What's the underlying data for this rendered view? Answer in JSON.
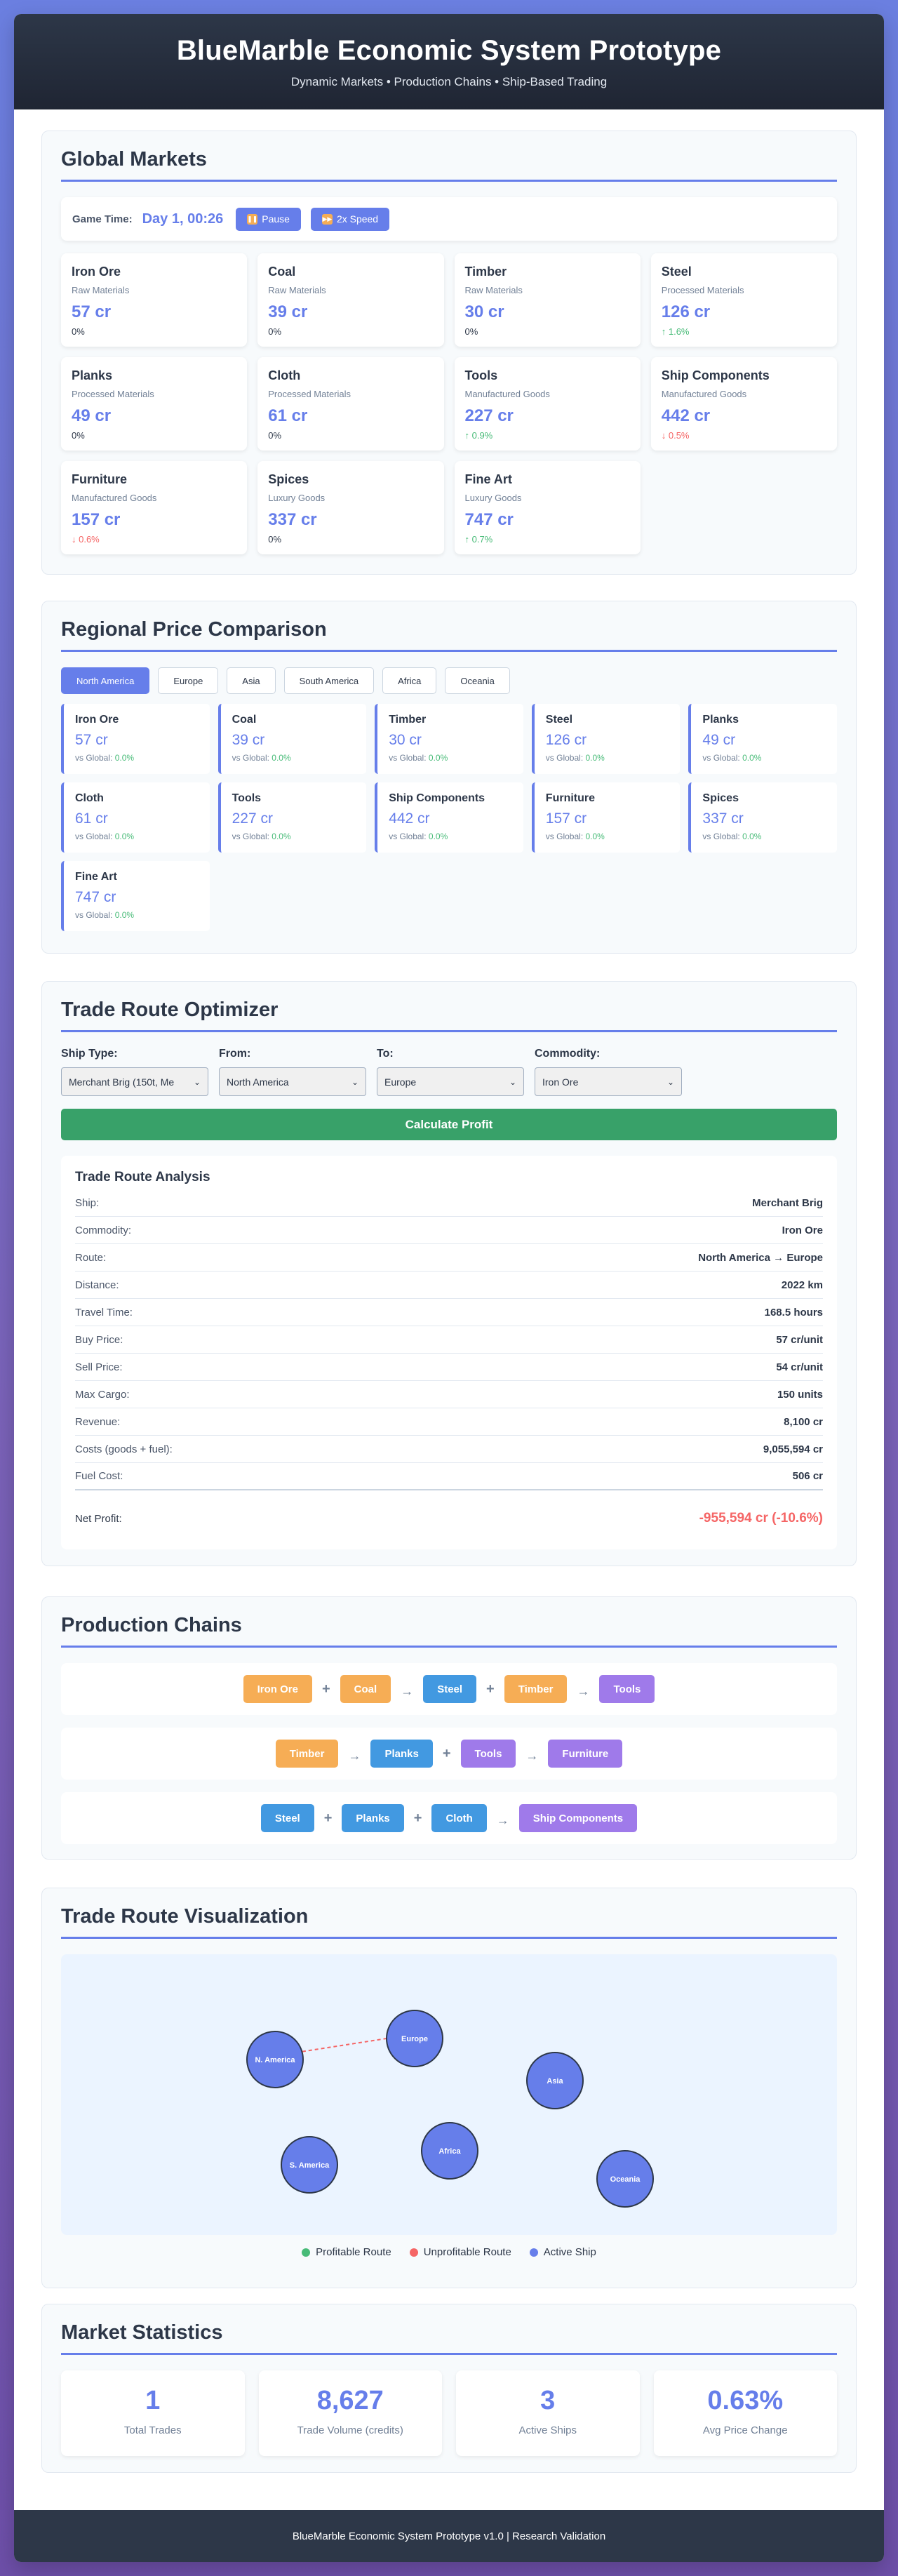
{
  "header": {
    "title": "BlueMarble Economic System Prototype",
    "subtitle": "Dynamic Markets • Production Chains • Ship-Based Trading"
  },
  "global_markets": {
    "title": "Global Markets",
    "game_time_label": "Game Time:",
    "game_time": "Day 1, 00:26",
    "pause_label": "Pause",
    "speed_label": "2x Speed",
    "items": [
      {
        "name": "Iron Ore",
        "category": "Raw Materials",
        "price": "57 cr",
        "change": "0%",
        "trend": "flat"
      },
      {
        "name": "Coal",
        "category": "Raw Materials",
        "price": "39 cr",
        "change": "0%",
        "trend": "flat"
      },
      {
        "name": "Timber",
        "category": "Raw Materials",
        "price": "30 cr",
        "change": "0%",
        "trend": "flat"
      },
      {
        "name": "Steel",
        "category": "Processed Materials",
        "price": "126 cr",
        "change": "↑ 1.6%",
        "trend": "up"
      },
      {
        "name": "Planks",
        "category": "Processed Materials",
        "price": "49 cr",
        "change": "0%",
        "trend": "flat"
      },
      {
        "name": "Cloth",
        "category": "Processed Materials",
        "price": "61 cr",
        "change": "0%",
        "trend": "flat"
      },
      {
        "name": "Tools",
        "category": "Manufactured Goods",
        "price": "227 cr",
        "change": "↑ 0.9%",
        "trend": "up"
      },
      {
        "name": "Ship Components",
        "category": "Manufactured Goods",
        "price": "442 cr",
        "change": "↓ 0.5%",
        "trend": "down"
      },
      {
        "name": "Furniture",
        "category": "Manufactured Goods",
        "price": "157 cr",
        "change": "↓ 0.6%",
        "trend": "down"
      },
      {
        "name": "Spices",
        "category": "Luxury Goods",
        "price": "337 cr",
        "change": "0%",
        "trend": "flat"
      },
      {
        "name": "Fine Art",
        "category": "Luxury Goods",
        "price": "747 cr",
        "change": "↑ 0.7%",
        "trend": "up"
      }
    ]
  },
  "regional": {
    "title": "Regional Price Comparison",
    "tabs": [
      "North America",
      "Europe",
      "Asia",
      "South America",
      "Africa",
      "Oceania"
    ],
    "active_tab": "North America",
    "vs_label": "vs Global:",
    "items": [
      {
        "name": "Iron Ore",
        "price": "57 cr",
        "vs": "0.0%"
      },
      {
        "name": "Coal",
        "price": "39 cr",
        "vs": "0.0%"
      },
      {
        "name": "Timber",
        "price": "30 cr",
        "vs": "0.0%"
      },
      {
        "name": "Steel",
        "price": "126 cr",
        "vs": "0.0%"
      },
      {
        "name": "Planks",
        "price": "49 cr",
        "vs": "0.0%"
      },
      {
        "name": "Cloth",
        "price": "61 cr",
        "vs": "0.0%"
      },
      {
        "name": "Tools",
        "price": "227 cr",
        "vs": "0.0%"
      },
      {
        "name": "Ship Components",
        "price": "442 cr",
        "vs": "0.0%"
      },
      {
        "name": "Furniture",
        "price": "157 cr",
        "vs": "0.0%"
      },
      {
        "name": "Spices",
        "price": "337 cr",
        "vs": "0.0%"
      },
      {
        "name": "Fine Art",
        "price": "747 cr",
        "vs": "0.0%"
      }
    ]
  },
  "optimizer": {
    "title": "Trade Route Optimizer",
    "fields": [
      {
        "label": "Ship Type:",
        "value": "Merchant Brig (150t, Me"
      },
      {
        "label": "From:",
        "value": "North America"
      },
      {
        "label": "To:",
        "value": "Europe"
      },
      {
        "label": "Commodity:",
        "value": "Iron Ore"
      }
    ],
    "calc_label": "Calculate Profit",
    "analysis_title": "Trade Route Analysis",
    "rows": [
      {
        "k": "Ship:",
        "v": "Merchant Brig"
      },
      {
        "k": "Commodity:",
        "v": "Iron Ore"
      },
      {
        "k": "Route:",
        "v": "North America → Europe"
      },
      {
        "k": "Distance:",
        "v": "2022 km"
      },
      {
        "k": "Travel Time:",
        "v": "168.5 hours"
      },
      {
        "k": "Buy Price:",
        "v": "57 cr/unit"
      },
      {
        "k": "Sell Price:",
        "v": "54 cr/unit"
      },
      {
        "k": "Max Cargo:",
        "v": "150 units"
      },
      {
        "k": "Revenue:",
        "v": "8,100 cr"
      },
      {
        "k": "Costs (goods + fuel):",
        "v": "9,055,594 cr"
      },
      {
        "k": "Fuel Cost:",
        "v": "506 cr"
      }
    ],
    "net_profit_label": "Net Profit:",
    "net_profit": "-955,594 cr (-10.6%)"
  },
  "production": {
    "title": "Production Chains",
    "chains": [
      [
        {
          "t": "node",
          "label": "Iron Ore",
          "kind": "raw"
        },
        {
          "t": "op",
          "label": "+"
        },
        {
          "t": "node",
          "label": "Coal",
          "kind": "raw"
        },
        {
          "t": "arrow",
          "label": "→"
        },
        {
          "t": "node",
          "label": "Steel",
          "kind": "proc"
        },
        {
          "t": "op",
          "label": "+"
        },
        {
          "t": "node",
          "label": "Timber",
          "kind": "raw"
        },
        {
          "t": "arrow",
          "label": "→"
        },
        {
          "t": "node",
          "label": "Tools",
          "kind": "mfg"
        }
      ],
      [
        {
          "t": "node",
          "label": "Timber",
          "kind": "raw"
        },
        {
          "t": "arrow",
          "label": "→"
        },
        {
          "t": "node",
          "label": "Planks",
          "kind": "proc"
        },
        {
          "t": "op",
          "label": "+"
        },
        {
          "t": "node",
          "label": "Tools",
          "kind": "mfg"
        },
        {
          "t": "arrow",
          "label": "→"
        },
        {
          "t": "node",
          "label": "Furniture",
          "kind": "mfg"
        }
      ],
      [
        {
          "t": "node",
          "label": "Steel",
          "kind": "proc"
        },
        {
          "t": "op",
          "label": "+"
        },
        {
          "t": "node",
          "label": "Planks",
          "kind": "proc"
        },
        {
          "t": "op",
          "label": "+"
        },
        {
          "t": "node",
          "label": "Cloth",
          "kind": "proc"
        },
        {
          "t": "arrow",
          "label": "→"
        },
        {
          "t": "node",
          "label": "Ship Components",
          "kind": "mfg"
        }
      ]
    ]
  },
  "visualization": {
    "title": "Trade Route Visualization",
    "regions": [
      "N. America",
      "Europe",
      "Asia",
      "S. America",
      "Africa",
      "Oceania"
    ],
    "route": {
      "from": "N. America",
      "to": "Europe",
      "status": "unprofitable"
    },
    "legend": [
      {
        "label": "Profitable Route",
        "color": "#48bb78"
      },
      {
        "label": "Unprofitable Route",
        "color": "#f56565"
      },
      {
        "label": "Active Ship",
        "color": "#667eea"
      }
    ],
    "node_color": "#667eea"
  },
  "stats": {
    "title": "Market Statistics",
    "items": [
      {
        "value": "1",
        "label": "Total Trades"
      },
      {
        "value": "8,627",
        "label": "Trade Volume (credits)"
      },
      {
        "value": "3",
        "label": "Active Ships"
      },
      {
        "value": "0.63%",
        "label": "Avg Price Change"
      }
    ]
  },
  "footer": {
    "text": "BlueMarble Economic System Prototype v1.0 | Research Validation"
  }
}
